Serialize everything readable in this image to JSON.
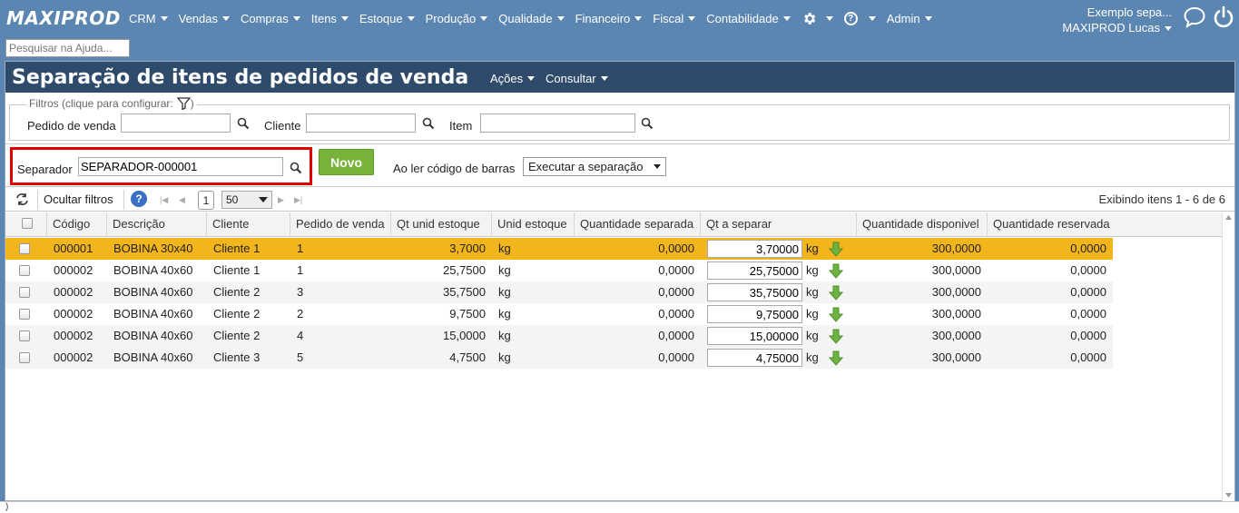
{
  "app": {
    "logo": "MAXIPROD",
    "menu": [
      {
        "label": "CRM"
      },
      {
        "label": "Vendas"
      },
      {
        "label": "Compras"
      },
      {
        "label": "Itens"
      },
      {
        "label": "Estoque"
      },
      {
        "label": "Produção"
      },
      {
        "label": "Qualidade"
      },
      {
        "label": "Financeiro"
      },
      {
        "label": "Fiscal"
      },
      {
        "label": "Contabilidade"
      }
    ],
    "admin_label": "Admin",
    "help_glyph": "?",
    "user": {
      "company": "Exemplo sepa...",
      "name": "MAXIPROD Lucas"
    },
    "help_search_placeholder": "Pesquisar na Ajuda..."
  },
  "page": {
    "title": "Separação de itens de pedidos de venda",
    "actions_label": "Ações",
    "consult_label": "Consultar"
  },
  "filters": {
    "legend": "Filtros (clique para configurar:",
    "legend_close": ")",
    "pedido_label": "Pedido de venda",
    "cliente_label": "Cliente",
    "item_label": "Item",
    "pedido_value": "",
    "cliente_value": "",
    "item_value": ""
  },
  "separator": {
    "label": "Separador",
    "value": "SEPARADOR-000001",
    "new_button": "Novo",
    "barcode_label": "Ao ler código de barras",
    "barcode_option": "Executar a separação"
  },
  "toolbar": {
    "hide_filters": "Ocultar filtros",
    "help_glyph": "?",
    "page": "1",
    "page_size": "50",
    "status": "Exibindo itens 1 - 6 de 6"
  },
  "grid": {
    "headers": [
      "Código",
      "Descrição",
      "Cliente",
      "Pedido de venda",
      "Qt unid estoque",
      "Unid estoque",
      "Quantidade separada",
      "Qt a separar",
      "Quantidade disponivel",
      "Quantidade reservada"
    ],
    "rows": [
      {
        "codigo": "000001",
        "descricao": "BOBINA 30x40",
        "cliente": "Cliente 1",
        "pedido": "1",
        "qt_estoque": "3,7000",
        "unid": "kg",
        "separada": "0,0000",
        "a_separar": "3,70000",
        "a_separar_unit": "kg",
        "disponivel": "300,0000",
        "reservada": "0,0000"
      },
      {
        "codigo": "000002",
        "descricao": "BOBINA 40x60",
        "cliente": "Cliente 1",
        "pedido": "1",
        "qt_estoque": "25,7500",
        "unid": "kg",
        "separada": "0,0000",
        "a_separar": "25,75000",
        "a_separar_unit": "kg",
        "disponivel": "300,0000",
        "reservada": "0,0000"
      },
      {
        "codigo": "000002",
        "descricao": "BOBINA 40x60",
        "cliente": "Cliente 2",
        "pedido": "3",
        "qt_estoque": "35,7500",
        "unid": "kg",
        "separada": "0,0000",
        "a_separar": "35,75000",
        "a_separar_unit": "kg",
        "disponivel": "300,0000",
        "reservada": "0,0000"
      },
      {
        "codigo": "000002",
        "descricao": "BOBINA 40x60",
        "cliente": "Cliente 2",
        "pedido": "2",
        "qt_estoque": "9,7500",
        "unid": "kg",
        "separada": "0,0000",
        "a_separar": "9,75000",
        "a_separar_unit": "kg",
        "disponivel": "300,0000",
        "reservada": "0,0000"
      },
      {
        "codigo": "000002",
        "descricao": "BOBINA 40x60",
        "cliente": "Cliente 2",
        "pedido": "4",
        "qt_estoque": "15,0000",
        "unid": "kg",
        "separada": "0,0000",
        "a_separar": "15,00000",
        "a_separar_unit": "kg",
        "disponivel": "300,0000",
        "reservada": "0,0000"
      },
      {
        "codigo": "000002",
        "descricao": "BOBINA 40x60",
        "cliente": "Cliente 3",
        "pedido": "5",
        "qt_estoque": "4,7500",
        "unid": "kg",
        "separada": "0,0000",
        "a_separar": "4,75000",
        "a_separar_unit": "kg",
        "disponivel": "300,0000",
        "reservada": "0,0000"
      }
    ]
  },
  "bottom_text": ")",
  "colors": {
    "nav": "#5b86b2",
    "title_bar": "#2f4b6b",
    "selected_row": "#f2b51c",
    "new_button": "#79b33b",
    "highlight_box": "#e00000"
  }
}
